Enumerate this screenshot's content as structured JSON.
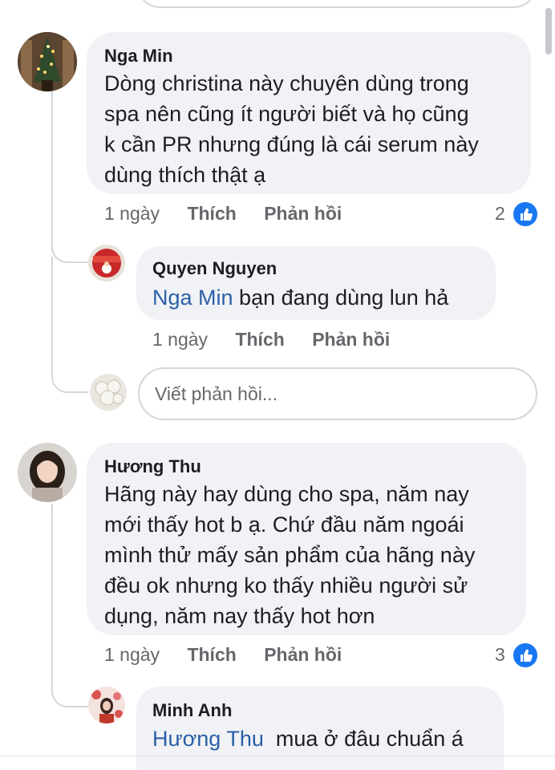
{
  "comments": [
    {
      "author": "Nga Min",
      "lines": [
        "Dòng christina này chuyên dùng trong",
        "spa nên cũng ít người biết và họ cũng",
        "k cần PR nhưng đúng là cái serum này",
        "dùng thích thật ạ"
      ],
      "time": "1 ngày",
      "like_label": "Thích",
      "reply_label": "Phản hồi",
      "reaction_count": "2",
      "reaction_icon": "like-icon",
      "replies": [
        {
          "author": "Quyen Nguyen",
          "mention": "Nga Min",
          "text": " bạn đang dùng lun hả",
          "time": "1 ngày",
          "like_label": "Thích",
          "reply_label": "Phản hồi"
        }
      ],
      "reply_input_placeholder": "Viết phản hồi..."
    },
    {
      "author": "Hương Thu",
      "lines": [
        "Hãng này hay dùng cho spa, năm nay",
        "mới thấy hot b ạ. Chứ đầu năm ngoái",
        "mình thử mấy sản phẩm của hãng này",
        "đều ok nhưng ko thấy nhiều người sử",
        "dụng, năm nay thấy hot hơn"
      ],
      "time": "1 ngày",
      "like_label": "Thích",
      "reply_label": "Phản hồi",
      "reaction_count": "3",
      "reaction_icon": "like-icon",
      "replies": [
        {
          "author": "Minh Anh",
          "mention": "Hương Thu",
          "text": "  mua ở đâu chuẩn á"
        }
      ]
    }
  ],
  "colors": {
    "bubble": "#f0f2f5",
    "mention": "#2a5fa8",
    "meta": "#65676b",
    "like_blue": "#1877f2"
  }
}
